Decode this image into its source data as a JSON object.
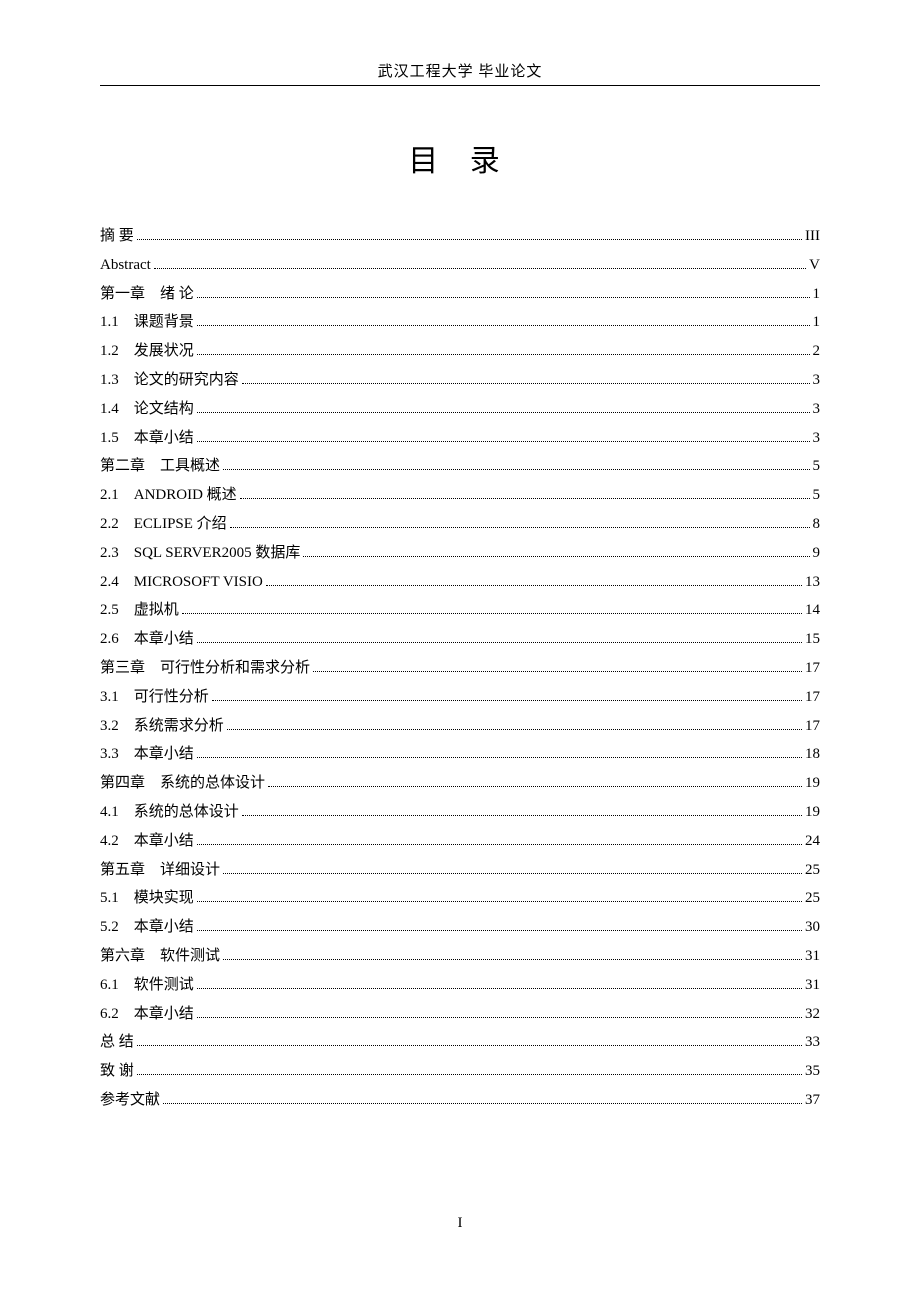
{
  "header": {
    "university": "武汉工程大学",
    "doctype": "毕业论文"
  },
  "toc_title": "目 录",
  "page_number": "I",
  "entries": [
    {
      "label": "摘 要",
      "page": "III",
      "indent": 0,
      "en": false
    },
    {
      "label": "Abstract",
      "page": "V",
      "indent": 0,
      "en": true
    },
    {
      "label": "第一章 绪 论",
      "page": "1",
      "indent": 0,
      "en": false
    },
    {
      "label": "1.1 课题背景",
      "page": "1",
      "indent": 0,
      "en": false
    },
    {
      "label": "1.2 发展状况",
      "page": "2",
      "indent": 0,
      "en": false
    },
    {
      "label": "1.3 论文的研究内容",
      "page": "3",
      "indent": 0,
      "en": false
    },
    {
      "label": "1.4 论文结构",
      "page": "3",
      "indent": 0,
      "en": false
    },
    {
      "label": "1.5 本章小结",
      "page": "3",
      "indent": 0,
      "en": false
    },
    {
      "label": "第二章 工具概述",
      "page": "5",
      "indent": 0,
      "en": false
    },
    {
      "label": "2.1 ANDROID 概述",
      "page": "5",
      "indent": 0,
      "en": false
    },
    {
      "label": "2.2 ECLIPSE 介绍",
      "page": "8",
      "indent": 0,
      "en": false
    },
    {
      "label": "2.3 SQL SERVER2005 数据库",
      "page": "9",
      "indent": 0,
      "en": false
    },
    {
      "label": "2.4 MICROSOFT VISIO",
      "page": "13",
      "indent": 0,
      "en": false
    },
    {
      "label": "2.5 虚拟机",
      "page": "14",
      "indent": 0,
      "en": false
    },
    {
      "label": "2.6 本章小结",
      "page": "15",
      "indent": 0,
      "en": false
    },
    {
      "label": "第三章 可行性分析和需求分析",
      "page": "17",
      "indent": 0,
      "en": false
    },
    {
      "label": "3.1 可行性分析",
      "page": "17",
      "indent": 0,
      "en": false
    },
    {
      "label": "3.2 系统需求分析",
      "page": "17",
      "indent": 0,
      "en": false
    },
    {
      "label": "3.3 本章小结",
      "page": "18",
      "indent": 0,
      "en": false
    },
    {
      "label": "第四章 系统的总体设计",
      "page": "19",
      "indent": 0,
      "en": false
    },
    {
      "label": "4.1 系统的总体设计",
      "page": "19",
      "indent": 0,
      "en": false
    },
    {
      "label": "4.2 本章小结",
      "page": "24",
      "indent": 0,
      "en": false
    },
    {
      "label": "第五章 详细设计",
      "page": "25",
      "indent": 0,
      "en": false
    },
    {
      "label": "5.1 模块实现",
      "page": "25",
      "indent": 0,
      "en": false
    },
    {
      "label": "5.2 本章小结",
      "page": "30",
      "indent": 0,
      "en": false
    },
    {
      "label": "第六章 软件测试",
      "page": "31",
      "indent": 0,
      "en": false
    },
    {
      "label": "6.1 软件测试",
      "page": "31",
      "indent": 0,
      "en": false
    },
    {
      "label": "6.2 本章小结",
      "page": "32",
      "indent": 0,
      "en": false
    },
    {
      "label": "总 结",
      "page": "33",
      "indent": 0,
      "en": false
    },
    {
      "label": "致 谢",
      "page": "35",
      "indent": 0,
      "en": false
    },
    {
      "label": "参考文献",
      "page": "37",
      "indent": 0,
      "en": false
    }
  ]
}
